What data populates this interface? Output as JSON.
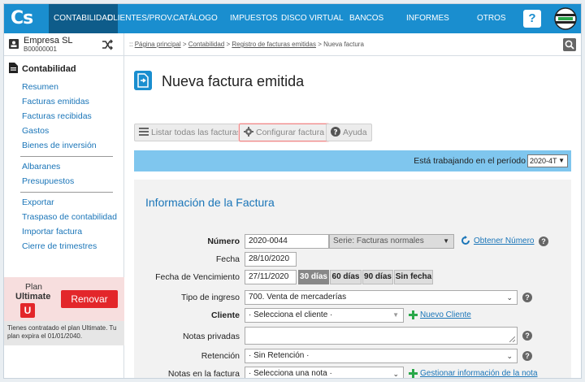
{
  "topnav": {
    "logo": "Cs",
    "items": [
      "CONTABILIDAD",
      "CLIENTES/PROV.",
      "CATÁLOGO",
      "IMPUESTOS",
      "DISCO VIRTUAL",
      "BANCOS",
      "INFORMES",
      "OTROS"
    ],
    "help": "?"
  },
  "sidebar": {
    "company_name": "Empresa SL",
    "company_code": "B00000001",
    "section_title": "Contabilidad",
    "group1": [
      "Resumen",
      "Facturas emitidas",
      "Facturas recibidas",
      "Gastos",
      "Bienes de inversión"
    ],
    "group2": [
      "Albaranes",
      "Presupuestos"
    ],
    "group3": [
      "Exportar",
      "Traspaso de contabilidad",
      "Importar factura",
      "Cierre de trimestres"
    ],
    "plan_label": "Plan",
    "plan_name": "Ultimate",
    "plan_badge": "U",
    "renew_label": "Renovar",
    "plan_note": "Tienes contratado el plan Ultimate. Tu plan expira el 01/01/2040."
  },
  "breadcrumb": {
    "prefix": "::",
    "links": [
      "Página principal",
      "Contabilidad",
      "Registro de facturas emitidas"
    ],
    "current": "Nueva factura"
  },
  "page": {
    "title": "Nueva factura emitida"
  },
  "toolbar": {
    "list_label": "Listar todas las facturas",
    "config_label": "Configurar factura",
    "help_label": "Ayuda"
  },
  "period": {
    "text": "Está trabajando en el período",
    "value": "2020-4T"
  },
  "form": {
    "section_title": "Información de la Factura",
    "numero_label": "Número",
    "numero_value": "2020-0044",
    "serie_value": "Serie: Facturas normales",
    "obtener_numero": "Obtener Número",
    "fecha_label": "Fecha",
    "fecha_value": "28/10/2020",
    "vencimiento_label": "Fecha de Vencimiento",
    "vencimiento_value": "27/11/2020",
    "vencimiento_options": [
      "30 días",
      "60 días",
      "90 días",
      "Sin fecha"
    ],
    "tipo_label": "Tipo de ingreso",
    "tipo_value": "700. Venta de mercaderías",
    "cliente_label": "Cliente",
    "cliente_value": "· Selecciona el cliente ·",
    "nuevo_cliente": "Nuevo Cliente",
    "notas_privadas_label": "Notas privadas",
    "retencion_label": "Retención",
    "retencion_value": "· Sin Retención ·",
    "notas_factura_label": "Notas en la factura",
    "notas_factura_value": "· Selecciona una nota ·",
    "gestionar_nota": "Gestionar información de la nota"
  },
  "colors": {
    "nav_bg": "#1a8ecf",
    "nav_active": "#0e5c8a",
    "link": "#1a75b8",
    "renew": "#e3262a",
    "period_bar": "#7fc6ee"
  }
}
